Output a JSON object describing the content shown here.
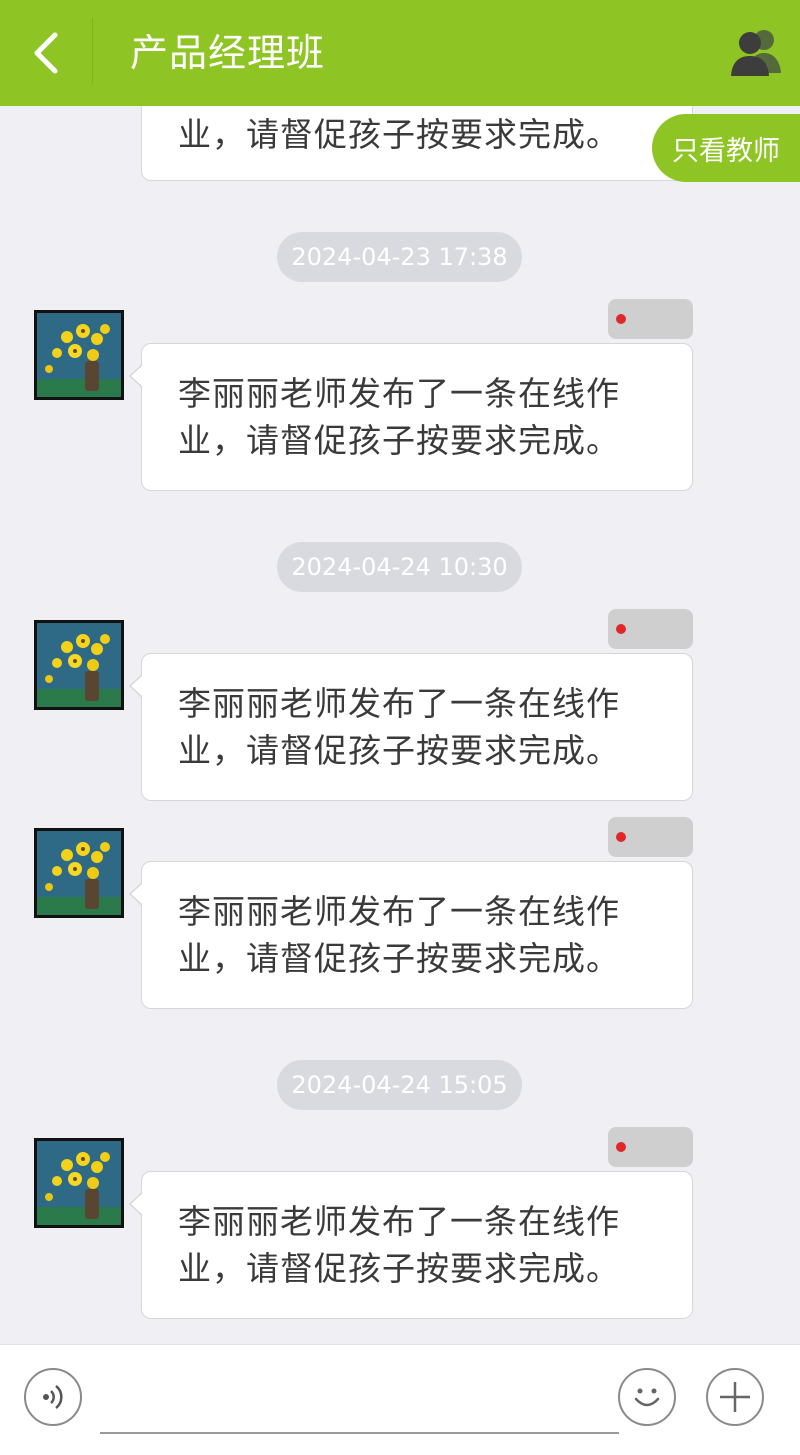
{
  "header": {
    "title": "产品经理班",
    "back_icon": "chevron-left-icon",
    "members_icon": "group-icon",
    "bg_color": "#8ec424"
  },
  "filter": {
    "label": "只看教师"
  },
  "partial_message": {
    "line2": "业，请督促孩子按要求完成。"
  },
  "timestamps": [
    "2024-04-23 17:38",
    "2024-04-24 10:30",
    "2024-04-24 15:05"
  ],
  "messages": [
    {
      "line1": "李丽丽老师发布了一条在线作",
      "line2": "业，请督促孩子按要求完成。"
    },
    {
      "line1": "李丽丽老师发布了一条在线作",
      "line2": "业，请督促孩子按要求完成。"
    },
    {
      "line1": "李丽丽老师发布了一条在线作",
      "line2": "业，请督促孩子按要求完成。"
    },
    {
      "line1": "李丽丽老师发布了一条在线作",
      "line2": "业，请督促孩子按要求完成。"
    }
  ],
  "input_bar": {
    "voice_icon": "voice-icon",
    "emoji_icon": "emoji-icon",
    "plus_icon": "plus-icon",
    "placeholder": ""
  }
}
